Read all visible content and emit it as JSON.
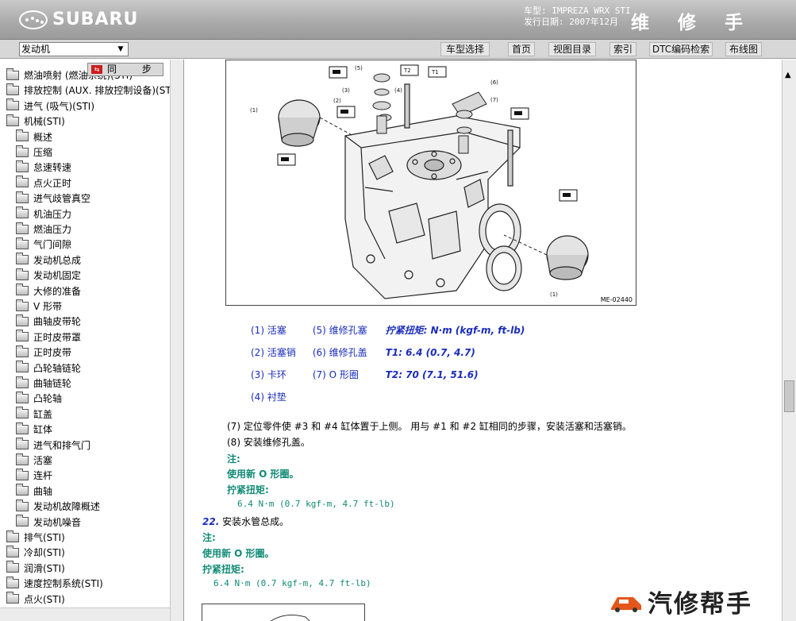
{
  "header": {
    "logo_text": "SUBARU",
    "model_line": "车型: IMPREZA WRX STI",
    "date_line": "发行日期: 2007年12月",
    "manual_title": "维 修 手 册"
  },
  "toolbar": {
    "section_select": "发动机",
    "buttons": [
      "车型选择",
      "首页",
      "视图目录",
      "索引",
      "DTC编码检索",
      "布线图"
    ]
  },
  "tree": {
    "sync_label": "同 步",
    "sync_flag": "⇆",
    "items": [
      {
        "label": "燃油喷射 (燃油系统)(STI)",
        "level": 0
      },
      {
        "label": "排放控制 (AUX. 排放控制设备)(STI)",
        "level": 0
      },
      {
        "label": "进气 (吸气)(STI)",
        "level": 0
      },
      {
        "label": "机械(STI)",
        "level": 0
      },
      {
        "label": "概述",
        "level": 1
      },
      {
        "label": "压缩",
        "level": 1
      },
      {
        "label": "怠速转速",
        "level": 1
      },
      {
        "label": "点火正时",
        "level": 1
      },
      {
        "label": "进气歧管真空",
        "level": 1
      },
      {
        "label": "机油压力",
        "level": 1
      },
      {
        "label": "燃油压力",
        "level": 1
      },
      {
        "label": "气门间隙",
        "level": 1
      },
      {
        "label": "发动机总成",
        "level": 1
      },
      {
        "label": "发动机固定",
        "level": 1
      },
      {
        "label": "大修的准备",
        "level": 1
      },
      {
        "label": "V 形带",
        "level": 1
      },
      {
        "label": "曲轴皮带轮",
        "level": 1
      },
      {
        "label": "正时皮带罩",
        "level": 1
      },
      {
        "label": "正时皮带",
        "level": 1
      },
      {
        "label": "凸轮轴链轮",
        "level": 1
      },
      {
        "label": "曲轴链轮",
        "level": 1
      },
      {
        "label": "凸轮轴",
        "level": 1
      },
      {
        "label": "缸盖",
        "level": 1
      },
      {
        "label": "缸体",
        "level": 1
      },
      {
        "label": "进气和排气门",
        "level": 1
      },
      {
        "label": "活塞",
        "level": 1
      },
      {
        "label": "连杆",
        "level": 1
      },
      {
        "label": "曲轴",
        "level": 1
      },
      {
        "label": "发动机故障概述",
        "level": 1
      },
      {
        "label": "发动机噪音",
        "level": 1
      },
      {
        "label": "排气(STI)",
        "level": 0
      },
      {
        "label": "冷却(STI)",
        "level": 0
      },
      {
        "label": "润滑(STI)",
        "level": 0
      },
      {
        "label": "速度控制系统(STI)",
        "level": 0
      },
      {
        "label": "点火(STI)",
        "level": 0
      }
    ]
  },
  "figure": {
    "code": "ME-02440",
    "labels": [
      "(1)",
      "(2)",
      "(3)",
      "(4)",
      "(5)",
      "(6)",
      "(7)",
      "T1",
      "T2",
      "★"
    ]
  },
  "legend": [
    {
      "a": "(1) 活塞",
      "b": "(5) 维修孔塞",
      "c": "拧紧扭矩: N·m (kgf-m, ft-lb)"
    },
    {
      "a": "(2) 活塞销",
      "b": "(6) 维修孔盖",
      "c": "T1:   6.4 (0.7, 4.7)"
    },
    {
      "a": "(3) 卡环",
      "b": "(7) O 形圈",
      "c": "T2:   70 (7.1, 51.6)"
    },
    {
      "a": "(4) 衬垫",
      "b": "",
      "c": ""
    }
  ],
  "steps": {
    "s7": "(7) 定位零件使 #3 和 #4 缸体置于上侧。 用与 #1 和 #2 缸相同的步骤，安装活塞和活塞销。",
    "s8": "(8) 安装维修孔盖。",
    "note1": "注:",
    "note1_text": "使用新 O 形圈。",
    "torque1_label": "拧紧扭矩:",
    "torque1_value": "6.4 N·m (0.7 kgf-m, 4.7 ft-lb)",
    "s22_num": "22.",
    "s22_text": "安装水管总成。",
    "note2": "注:",
    "note2_text": "使用新 O 形圈。",
    "torque2_label": "拧紧扭矩:",
    "torque2_value": "6.4 N·m (0.7 kgf-m, 4.7 ft-lb)"
  },
  "watermark": "汽修帮手"
}
